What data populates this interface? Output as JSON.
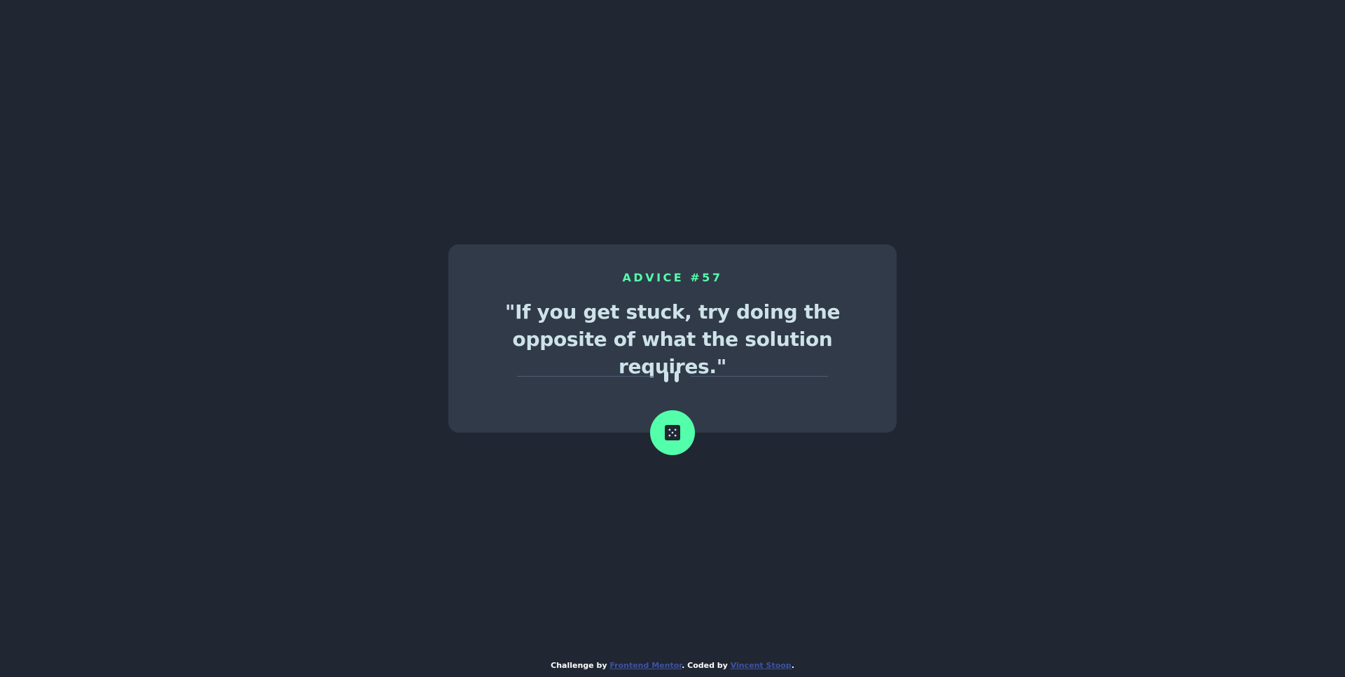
{
  "colors": {
    "background": "#202632",
    "card": "#313A48",
    "accent": "#53FFAA",
    "text": "#CEE3E9",
    "divider": "#4F5D74",
    "link": "#3E52A3"
  },
  "card": {
    "title": "ADVICE #57",
    "advice": "\"If you get stuck, try doing the opposite of what the solution requires.\"",
    "divider_icon": "pause-icon"
  },
  "button": {
    "icon": "dice-icon"
  },
  "footer": {
    "prefix": "Challenge by ",
    "challenge_link": "Frontend Mentor",
    "middle": ". Coded by ",
    "author_link": "Vincent Stoop",
    "suffix": "."
  }
}
